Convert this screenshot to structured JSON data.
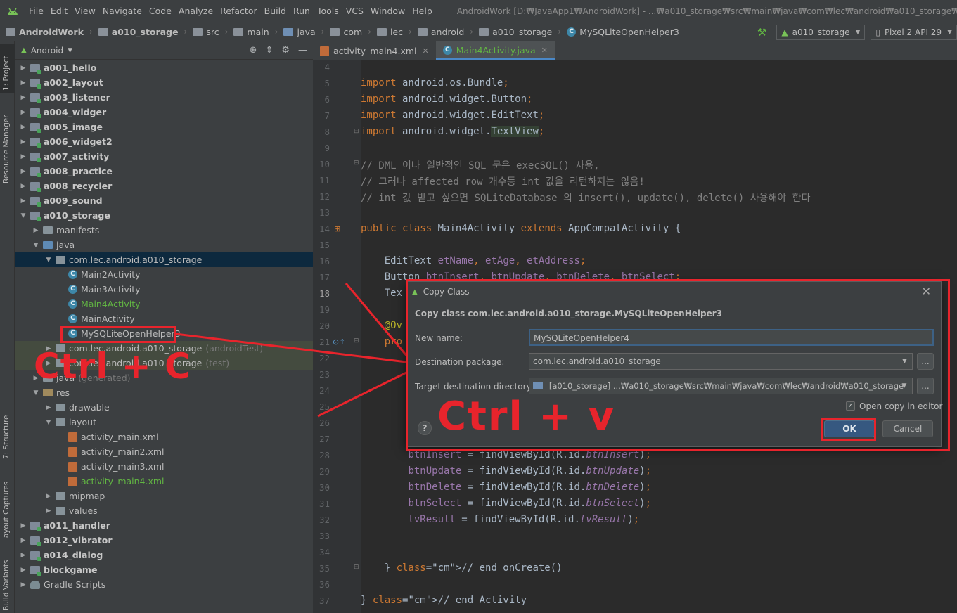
{
  "menu": {
    "items": [
      "File",
      "Edit",
      "View",
      "Navigate",
      "Code",
      "Analyze",
      "Refactor",
      "Build",
      "Run",
      "Tools",
      "VCS",
      "Window",
      "Help"
    ],
    "window_title": "AndroidWork [D:₩JavaApp1₩AndroidWork] - ...₩a010_storage₩src₩main₩java₩com₩lec₩android₩a010_storage₩Main4Activity.java [a010"
  },
  "breadcrumb": {
    "items": [
      "AndroidWork",
      "a010_storage",
      "src",
      "main",
      "java",
      "com",
      "lec",
      "android",
      "a010_storage",
      "MySQLiteOpenHelper3"
    ]
  },
  "toolbar": {
    "module_combo": "a010_storage",
    "device_combo": "Pixel 2 API 29"
  },
  "left_tools": {
    "project": "1: Project",
    "resource_manager": "Resource Manager",
    "structure": "7: Structure",
    "layout_captures": "Layout Captures",
    "build_variants": "Build Variants"
  },
  "project_panel": {
    "view_mode": "Android",
    "tree": [
      {
        "label": "a001_hello",
        "type": "module",
        "level": 0,
        "expand": "closed"
      },
      {
        "label": "a002_layout",
        "type": "module",
        "level": 0,
        "expand": "closed"
      },
      {
        "label": "a003_listener",
        "type": "module",
        "level": 0,
        "expand": "closed"
      },
      {
        "label": "a004_widger",
        "type": "module",
        "level": 0,
        "expand": "closed"
      },
      {
        "label": "a005_image",
        "type": "module",
        "level": 0,
        "expand": "closed"
      },
      {
        "label": "a006_widget2",
        "type": "module",
        "level": 0,
        "expand": "closed"
      },
      {
        "label": "a007_activity",
        "type": "module",
        "level": 0,
        "expand": "closed"
      },
      {
        "label": "a008_practice",
        "type": "module",
        "level": 0,
        "expand": "closed"
      },
      {
        "label": "a008_recycler",
        "type": "module",
        "level": 0,
        "expand": "closed"
      },
      {
        "label": "a009_sound",
        "type": "module",
        "level": 0,
        "expand": "closed"
      },
      {
        "label": "a010_storage",
        "type": "module",
        "level": 0,
        "expand": "open"
      },
      {
        "label": "manifests",
        "type": "folder",
        "level": 1,
        "expand": "closed"
      },
      {
        "label": "java",
        "type": "folder-blue",
        "level": 1,
        "expand": "open"
      },
      {
        "label": "com.lec.android.a010_storage",
        "type": "folder",
        "level": 2,
        "expand": "open",
        "state": "selected"
      },
      {
        "label": "Main2Activity",
        "type": "class",
        "level": 3,
        "expand": "none"
      },
      {
        "label": "Main3Activity",
        "type": "class",
        "level": 3,
        "expand": "none"
      },
      {
        "label": "Main4Activity",
        "type": "class",
        "level": 3,
        "expand": "none",
        "color": "green"
      },
      {
        "label": "MainActivity",
        "type": "class",
        "level": 3,
        "expand": "none"
      },
      {
        "label": "MySQLiteOpenHelper3",
        "type": "class",
        "level": 3,
        "expand": "none"
      },
      {
        "label": "com.lec.android.a010_storage",
        "suffix": "(androidTest)",
        "type": "folder",
        "level": 2,
        "expand": "closed",
        "state": "hl"
      },
      {
        "label": "com.lec.android.a010_storage",
        "suffix": "(test)",
        "type": "folder",
        "level": 2,
        "expand": "closed",
        "state": "hl"
      },
      {
        "label": "java",
        "suffix": "(generated)",
        "type": "folder",
        "level": 1,
        "expand": "closed"
      },
      {
        "label": "res",
        "type": "folder-res",
        "level": 1,
        "expand": "open"
      },
      {
        "label": "drawable",
        "type": "folder",
        "level": 2,
        "expand": "closed"
      },
      {
        "label": "layout",
        "type": "folder",
        "level": 2,
        "expand": "open"
      },
      {
        "label": "activity_main.xml",
        "type": "xml",
        "level": 3,
        "expand": "none"
      },
      {
        "label": "activity_main2.xml",
        "type": "xml",
        "level": 3,
        "expand": "none"
      },
      {
        "label": "activity_main3.xml",
        "type": "xml",
        "level": 3,
        "expand": "none"
      },
      {
        "label": "activity_main4.xml",
        "type": "xml",
        "level": 3,
        "expand": "none",
        "color": "green"
      },
      {
        "label": "mipmap",
        "type": "folder",
        "level": 2,
        "expand": "closed"
      },
      {
        "label": "values",
        "type": "folder",
        "level": 2,
        "expand": "closed"
      },
      {
        "label": "a011_handler",
        "type": "module",
        "level": 0,
        "expand": "closed"
      },
      {
        "label": "a012_vibrator",
        "type": "module",
        "level": 0,
        "expand": "closed"
      },
      {
        "label": "a014_dialog",
        "type": "module",
        "level": 0,
        "expand": "closed"
      },
      {
        "label": "blockgame",
        "type": "module",
        "level": 0,
        "expand": "closed"
      },
      {
        "label": "Gradle Scripts",
        "type": "gradle",
        "level": 0,
        "expand": "closed"
      }
    ]
  },
  "editor": {
    "tabs": [
      {
        "label": "activity_main4.xml",
        "active": false
      },
      {
        "label": "Main4Activity.java",
        "active": true
      }
    ],
    "current_line": "18",
    "lines": [
      {
        "n": "4",
        "code": ""
      },
      {
        "n": "5",
        "code": "import android.os.Bundle;"
      },
      {
        "n": "6",
        "code": "import android.widget.Button;"
      },
      {
        "n": "7",
        "code": "import android.widget.EditText;"
      },
      {
        "n": "8",
        "code": "import android.widget.TextView;"
      },
      {
        "n": "9",
        "code": ""
      },
      {
        "n": "10",
        "code": "// DML 이나 일반적인 SQL 문은 execSQL() 사용,"
      },
      {
        "n": "11",
        "code": "// 그러나 affected row 개수등 int 값을 리턴하지는 않음!"
      },
      {
        "n": "12",
        "code": "// int 값 받고 싶으면 SQLiteDatabase 의 insert(), update(), delete() 사용해야 한다"
      },
      {
        "n": "13",
        "code": ""
      },
      {
        "n": "14",
        "code": "public class Main4Activity extends AppCompatActivity {"
      },
      {
        "n": "15",
        "code": ""
      },
      {
        "n": "16",
        "code": "    EditText etName, etAge, etAddress;"
      },
      {
        "n": "17",
        "code": "    Button btnInsert, btnUpdate, btnDelete, btnSelect;"
      },
      {
        "n": "18",
        "code": "    Tex"
      },
      {
        "n": "19",
        "code": ""
      },
      {
        "n": "20",
        "code": "    @Ov"
      },
      {
        "n": "21",
        "code": "    pro"
      },
      {
        "n": "22",
        "code": ""
      },
      {
        "n": "23",
        "code": ""
      },
      {
        "n": "24",
        "code": ""
      },
      {
        "n": "25",
        "code": ""
      },
      {
        "n": "26",
        "code": ""
      },
      {
        "n": "27",
        "code": ""
      },
      {
        "n": "28",
        "code": "        btnInsert = findViewById(R.id.btnInsert);"
      },
      {
        "n": "29",
        "code": "        btnUpdate = findViewById(R.id.btnUpdate);"
      },
      {
        "n": "30",
        "code": "        btnDelete = findViewById(R.id.btnDelete);"
      },
      {
        "n": "31",
        "code": "        btnSelect = findViewById(R.id.btnSelect);"
      },
      {
        "n": "32",
        "code": "        tvResult = findViewById(R.id.tvResult);"
      },
      {
        "n": "33",
        "code": ""
      },
      {
        "n": "34",
        "code": ""
      },
      {
        "n": "35",
        "code": "    } // end onCreate()"
      },
      {
        "n": "36",
        "code": ""
      },
      {
        "n": "37",
        "code": "} // end Activity"
      }
    ]
  },
  "dialog": {
    "title": "Copy Class",
    "heading": "Copy class com.lec.android.a010_storage.MySQLiteOpenHelper3",
    "new_name_label": "New name:",
    "new_name_value": "MySQLiteOpenHelper4",
    "dest_package_label": "Destination package:",
    "dest_package_value": "com.lec.android.a010_storage",
    "target_dir_label": "Target destination directory:",
    "target_dir_value": "[a010_storage] ...₩a010_storage₩src₩main₩java₩com₩lec₩android₩a010_storage",
    "browse_label": "...",
    "open_copy_label": "Open copy in editor",
    "open_copy_checked": true,
    "help_label": "?",
    "ok_label": "OK",
    "cancel_label": "Cancel"
  },
  "annotations": {
    "copy_hint": "Ctrl + C",
    "paste_hint": "Ctrl + v",
    "color": "#e8242c"
  }
}
